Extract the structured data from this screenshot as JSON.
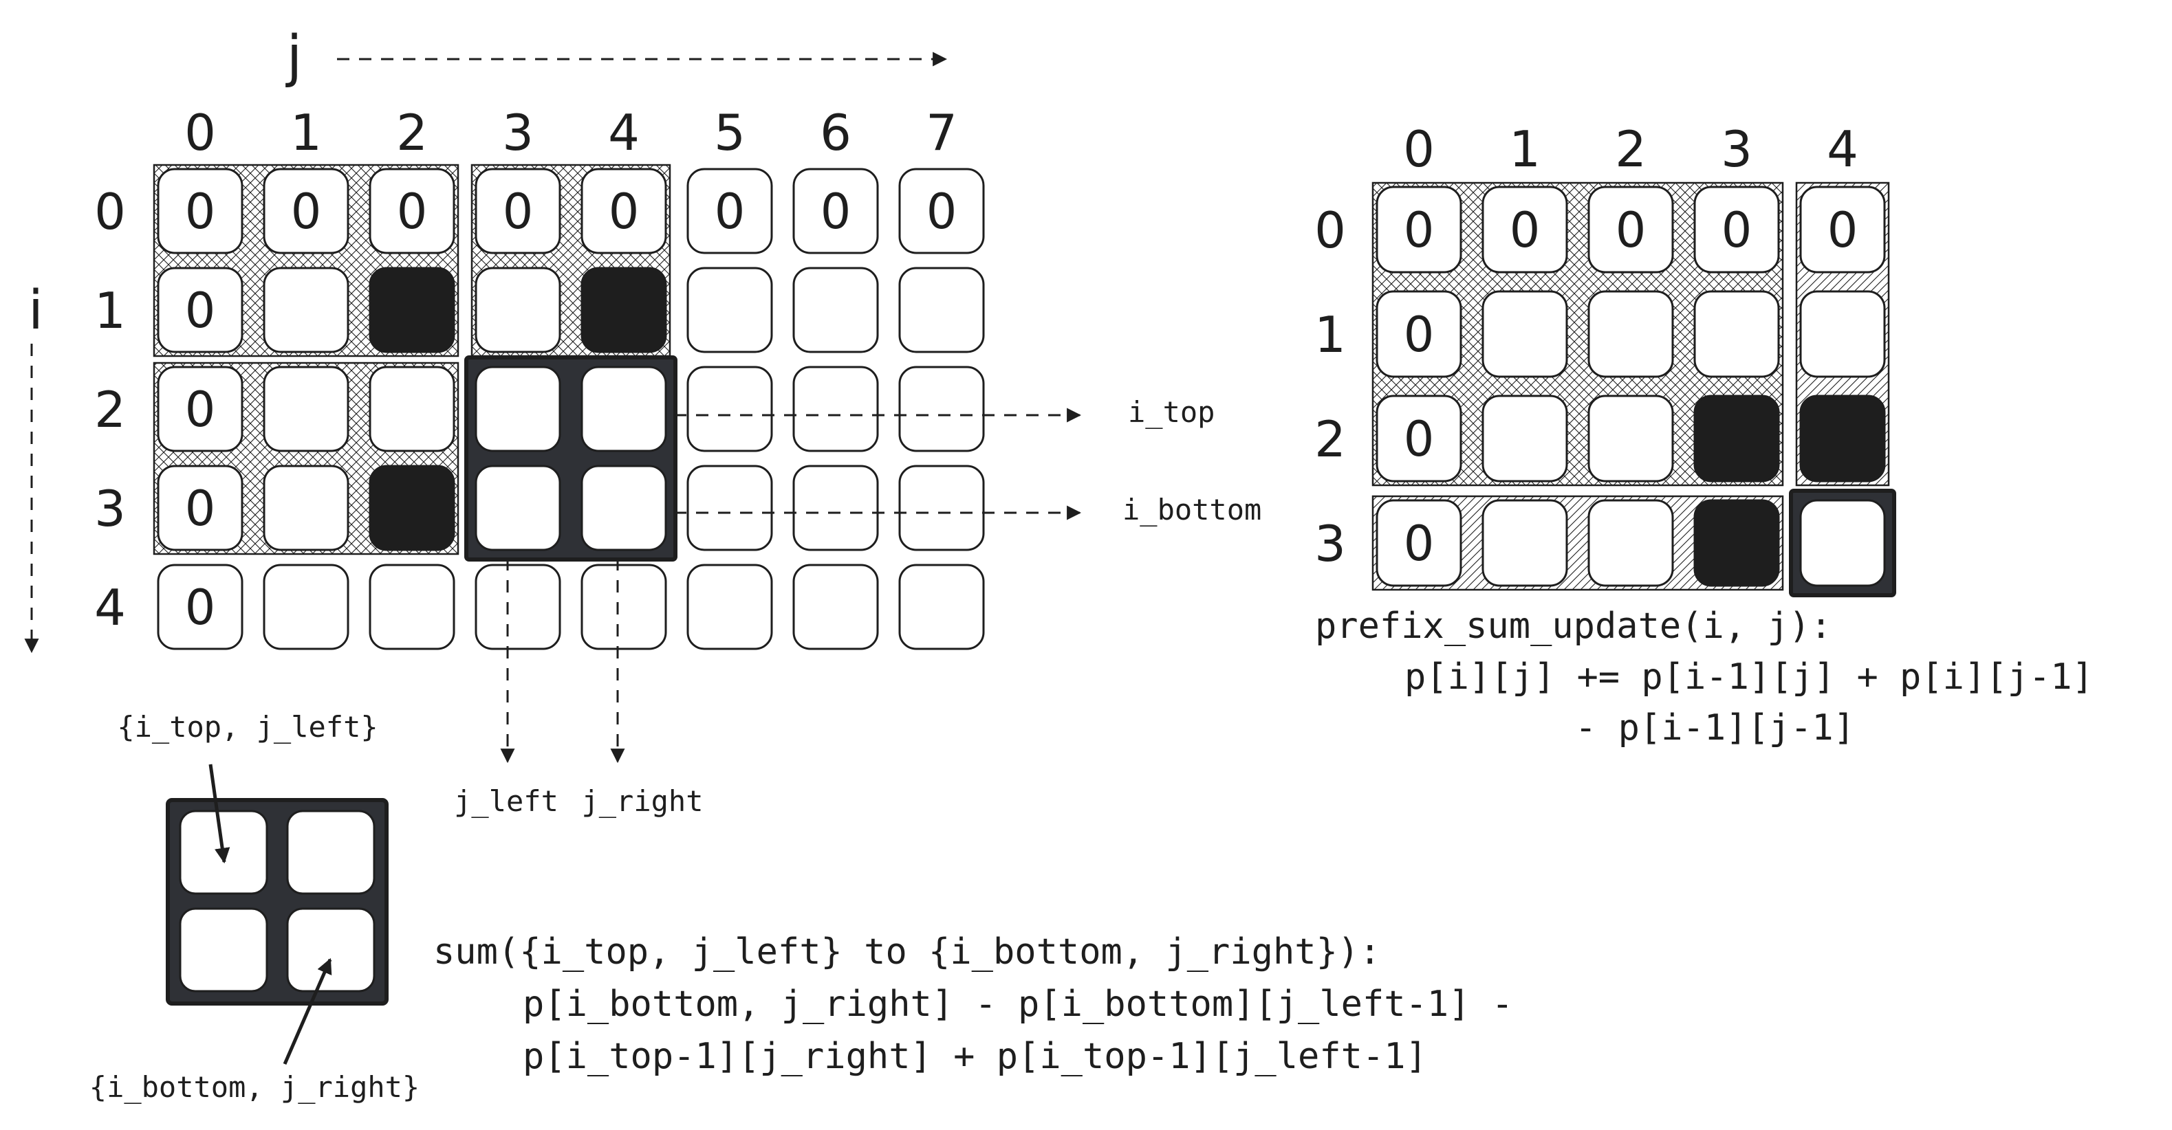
{
  "axes": {
    "j": "j",
    "i": "i"
  },
  "left_grid": {
    "col_labels": [
      "0",
      "1",
      "2",
      "3",
      "4",
      "5",
      "6",
      "7"
    ],
    "row_labels": [
      "0",
      "1",
      "2",
      "3",
      "4"
    ],
    "cells": [
      [
        "0",
        "0",
        "0",
        "0",
        "0",
        "0",
        "0",
        "0"
      ],
      [
        "0",
        "",
        "",
        "",
        "",
        "",
        "",
        ""
      ],
      [
        "0",
        "",
        "",
        "",
        "",
        "",
        "",
        ""
      ],
      [
        "0",
        "",
        "",
        "",
        "",
        "",
        "",
        ""
      ],
      [
        "0",
        "",
        "",
        "",
        "",
        "",
        "",
        ""
      ]
    ],
    "filled": [
      [
        1,
        2
      ],
      [
        1,
        4
      ],
      [
        3,
        2
      ]
    ],
    "query_rows": [
      2,
      3
    ],
    "query_cols": [
      3,
      4
    ]
  },
  "labels": {
    "i_top": "i_top",
    "i_bottom": "i_bottom",
    "j_left": "j_left",
    "j_right": "j_right",
    "top_left_corner": "{i_top, j_left}",
    "bottom_right_corner": "{i_bottom, j_right}"
  },
  "right_grid": {
    "col_labels": [
      "0",
      "1",
      "2",
      "3",
      "4"
    ],
    "row_labels": [
      "0",
      "1",
      "2",
      "3"
    ],
    "cells": [
      [
        "0",
        "0",
        "0",
        "0",
        "0"
      ],
      [
        "0",
        "",
        "",
        "",
        ""
      ],
      [
        "0",
        "",
        "",
        "",
        ""
      ],
      [
        "0",
        "",
        "",
        "",
        ""
      ]
    ],
    "filled": [
      [
        2,
        3
      ],
      [
        2,
        4
      ],
      [
        3,
        3
      ]
    ],
    "target": [
      3,
      4
    ]
  },
  "formulas": {
    "update": [
      "prefix_sum_update(i, j):",
      "p[i][j] += p[i-1][j] + p[i][j-1]",
      "- p[i-1][j-1]"
    ],
    "sum": [
      "sum({i_top, j_left}  to {i_bottom, j_right}):",
      "p[i_bottom, j_right] - p[i_bottom][j_left-1] -",
      "p[i_top-1][j_right] + p[i_top-1][j_left-1]"
    ]
  },
  "colors": {
    "ink": "#1e1e1e",
    "highlight": "#2f3136",
    "background": "#ffffff"
  }
}
